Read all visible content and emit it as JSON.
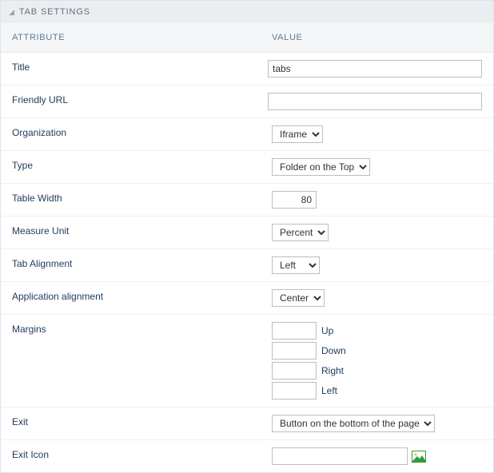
{
  "panel": {
    "title": "TAB SETTINGS"
  },
  "columns": {
    "attribute": "ATTRIBUTE",
    "value": "VALUE"
  },
  "fields": {
    "title": {
      "label": "Title",
      "value": "tabs"
    },
    "friendly_url": {
      "label": "Friendly URL",
      "value": ""
    },
    "organization": {
      "label": "Organization",
      "value": "Iframe"
    },
    "type": {
      "label": "Type",
      "value": "Folder on the Top"
    },
    "table_width": {
      "label": "Table Width",
      "value": "80"
    },
    "measure_unit": {
      "label": "Measure Unit",
      "value": "Percent"
    },
    "tab_alignment": {
      "label": "Tab Alignment",
      "value": "Left"
    },
    "app_alignment": {
      "label": "Application alignment",
      "value": "Center"
    },
    "margins": {
      "label": "Margins",
      "up": {
        "label": "Up",
        "value": ""
      },
      "down": {
        "label": "Down",
        "value": ""
      },
      "right": {
        "label": "Right",
        "value": ""
      },
      "left": {
        "label": "Left",
        "value": ""
      }
    },
    "exit": {
      "label": "Exit",
      "value": "Button on the bottom of the page"
    },
    "exit_icon": {
      "label": "Exit Icon",
      "value": ""
    }
  }
}
